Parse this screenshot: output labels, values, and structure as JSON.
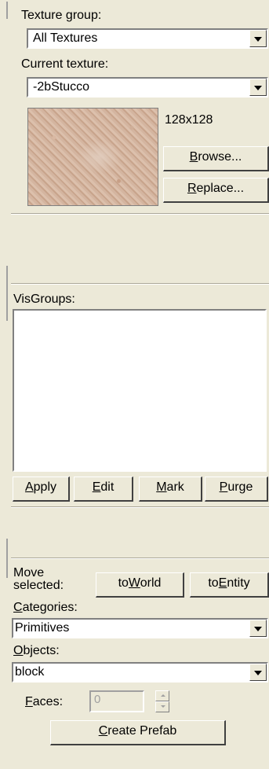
{
  "texture_panel": {
    "group_label": "Texture group:",
    "group_value": "All Textures",
    "current_label": "Current texture:",
    "current_value": "-2bStucco",
    "size_text": "128x128",
    "browse_label_pre": "",
    "browse_label_u": "B",
    "browse_label_post": "rowse...",
    "replace_label_u": "R",
    "replace_label_post": "eplace..."
  },
  "visgroups": {
    "label": "VisGroups:",
    "apply_u": "A",
    "apply_post": "pply",
    "edit_u": "E",
    "edit_post": "dit",
    "mark_u": "M",
    "mark_post": "ark",
    "purge_u": "P",
    "purge_post": "urge"
  },
  "objects_panel": {
    "move_label_1": "Move",
    "move_label_2": "selected:",
    "toworld_pre": "to",
    "toworld_u": "W",
    "toworld_post": "orld",
    "toentity_pre": "to",
    "toentity_u": "E",
    "toentity_post": "ntity",
    "categories_u": "C",
    "categories_post": "ategories:",
    "categories_value": "Primitives",
    "objects_u": "O",
    "objects_post": "bjects:",
    "objects_value": "block",
    "faces_u": "F",
    "faces_post": "aces:",
    "faces_value": "0",
    "create_u": "C",
    "create_post": "reate Prefab"
  }
}
